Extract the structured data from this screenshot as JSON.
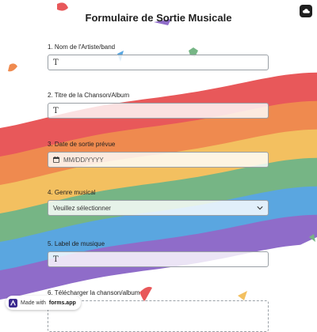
{
  "form": {
    "title": "Formulaire de Sortie Musicale"
  },
  "questions": [
    {
      "label": "1.  Nom de l'Artiste/band",
      "type": "text"
    },
    {
      "label": "2. Titre de la Chanson/Album",
      "type": "text"
    },
    {
      "label": "3. Date de sortie prévue",
      "type": "date",
      "placeholder": "MM/DD/YYYY"
    },
    {
      "label": "4. Genre musical",
      "type": "select",
      "value": "Veuillez sélectionner"
    },
    {
      "label": "5. Label de musique",
      "type": "text"
    },
    {
      "label": "6. Télécharger la chanson/album",
      "type": "upload"
    }
  ],
  "footer": {
    "made_with": "Made with",
    "brand": "forms.app"
  },
  "colors": {
    "rainbow": [
      "#e8585a",
      "#ef8a4f",
      "#f3c060",
      "#76b585",
      "#5aa6e0",
      "#8f6cc9"
    ],
    "text": "#1f1f1f",
    "field_border": "#9aa0a6"
  },
  "icons": {
    "top_button": "cloud-icon",
    "text_field": "text-type-icon",
    "date_field": "calendar-icon",
    "select": "chevron-down-icon",
    "footer": "forms-app-logo-icon"
  }
}
